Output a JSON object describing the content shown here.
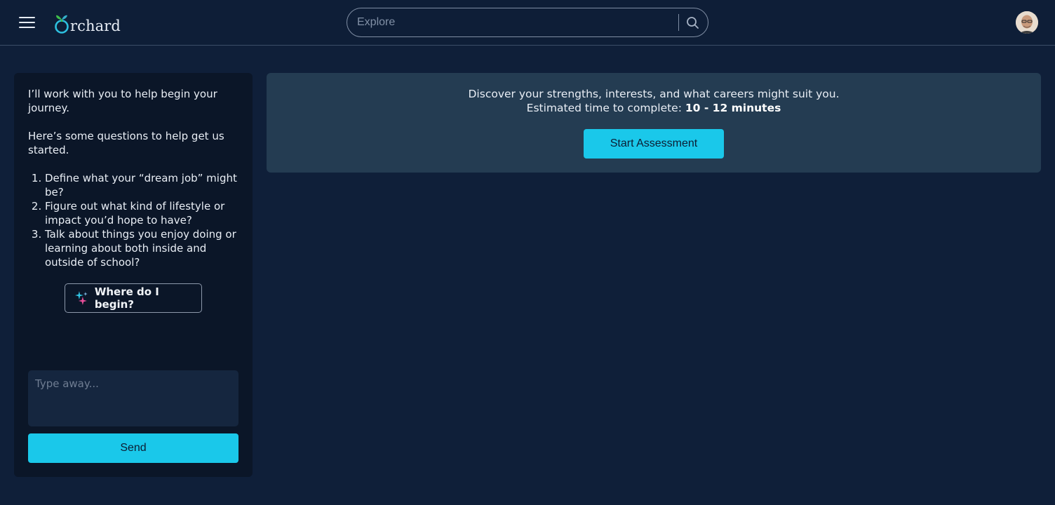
{
  "header": {
    "menu_icon": "hamburger-menu-icon",
    "logo_text": "rchard",
    "logo_icon": "orchard-sprout-icon",
    "search": {
      "placeholder": "Explore",
      "icon": "search-icon"
    },
    "avatar_icon": "user-avatar"
  },
  "chat": {
    "intro": "I’ll work with you to help begin your journey.",
    "prompt": "Here’s some questions to help get us started.",
    "questions": [
      "Define what your “dream job” might be?",
      "Figure out what kind of lifestyle or impact you’d hope to have?",
      "Talk about things you enjoy doing or learning about both inside and outside of school?"
    ],
    "begin_button": {
      "label": "Where do I begin?",
      "icon": "sparkle-icon"
    },
    "input_placeholder": "Type away...",
    "send_label": "Send"
  },
  "assessment": {
    "description": "Discover your strengths, interests, and what careers might suit you.",
    "time_prefix": "Estimated time to complete:",
    "time_value": "10 - 12 minutes",
    "start_label": "Start Assessment"
  },
  "colors": {
    "background": "#0f1f39",
    "accent": "#1ac8ea",
    "card": "#243c52",
    "panel": "#0b1628"
  }
}
